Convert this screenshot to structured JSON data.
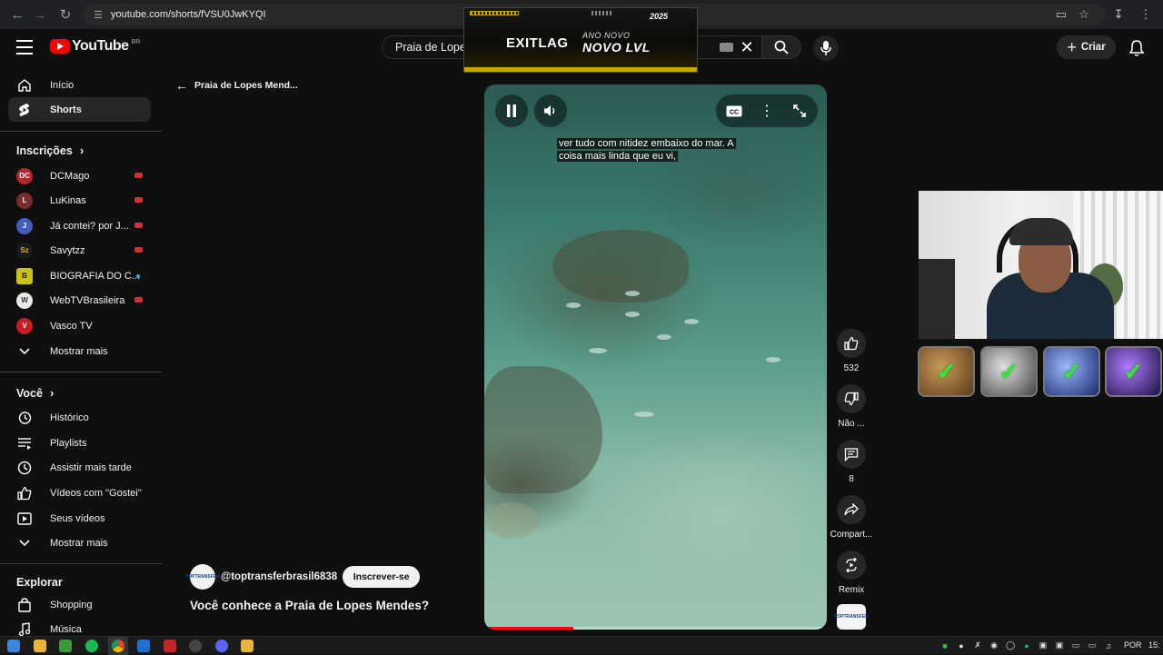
{
  "browser": {
    "url": "youtube.com/shorts/fVSU0JwKYQI",
    "nav_icons": [
      "back-arrow-icon",
      "forward-arrow-icon",
      "reload-icon"
    ],
    "right_icons": [
      "cast-icon",
      "bookmark-star-icon",
      "download-icon",
      "profile-icon"
    ]
  },
  "header": {
    "logo_text": "YouTube",
    "country_code": "BR",
    "search_value": "Praia de Lopes Mendes",
    "create_label": "Criar"
  },
  "ad_overlay": {
    "brand": "EXITLAG",
    "subtitle": "ANO NOVO",
    "headline": "NOVO LVL",
    "year": "2025"
  },
  "sidebar": {
    "main": [
      {
        "label": "Início",
        "icon": "home-icon"
      },
      {
        "label": "Shorts",
        "icon": "shorts-icon",
        "active": true
      }
    ],
    "subs_heading": "Inscrições",
    "subscriptions": [
      {
        "label": "DCMago",
        "badge": "live",
        "avatar_color": "#b3262a",
        "initials": "DC"
      },
      {
        "label": "LuKinas",
        "badge": "live",
        "avatar_color": "#7a2b2b",
        "initials": "L"
      },
      {
        "label": "Já contei? por J...",
        "badge": "live",
        "avatar_color": "#3e5fb5",
        "initials": "J"
      },
      {
        "label": "Savytzz",
        "badge": "live",
        "avatar_color": "#1b1b1b",
        "initials": "Sz"
      },
      {
        "label": "BIOGRAFIA DO C...",
        "badge": "dot",
        "avatar_color": "#c9c21a",
        "initials": "B"
      },
      {
        "label": "WebTVBrasileira",
        "badge": "live",
        "avatar_color": "#e9e9e9",
        "initials": "W"
      },
      {
        "label": "Vasco TV",
        "badge": "",
        "avatar_color": "#c61d23",
        "initials": "V"
      }
    ],
    "subs_more": "Mostrar mais",
    "you_heading": "Você",
    "you_items": [
      {
        "label": "Histórico",
        "icon": "history-icon"
      },
      {
        "label": "Playlists",
        "icon": "playlists-icon"
      },
      {
        "label": "Assistir mais tarde",
        "icon": "watch-later-icon"
      },
      {
        "label": "Vídeos com \"Gostei\"",
        "icon": "liked-icon"
      },
      {
        "label": "Seus vídeos",
        "icon": "your-videos-icon"
      }
    ],
    "you_more": "Mostrar mais",
    "explore_heading": "Explorar",
    "explore_items": [
      {
        "label": "Shopping",
        "icon": "shopping-bag-icon"
      },
      {
        "label": "Música",
        "icon": "music-note-icon"
      }
    ]
  },
  "shorts": {
    "back_title": "Praia de Lopes Mend...",
    "caption_line1": "ver tudo com nitidez embaixo do mar. A",
    "caption_line2": "coisa mais linda que eu vi,",
    "progress": 0.26,
    "channel": "@toptransferbrasil6838",
    "channel_logo_text": "TOPTRANSFER",
    "subscribe_label": "Inscrever-se",
    "title": "Você conhece a Praia de Lopes Mendes?",
    "actions": {
      "like_count": "532",
      "dislike_label": "Não ...",
      "comments_count": "8",
      "share_label": "Compart...",
      "remix_label": "Remix"
    }
  },
  "taskbar": {
    "lang": "POR",
    "time": "15:"
  }
}
